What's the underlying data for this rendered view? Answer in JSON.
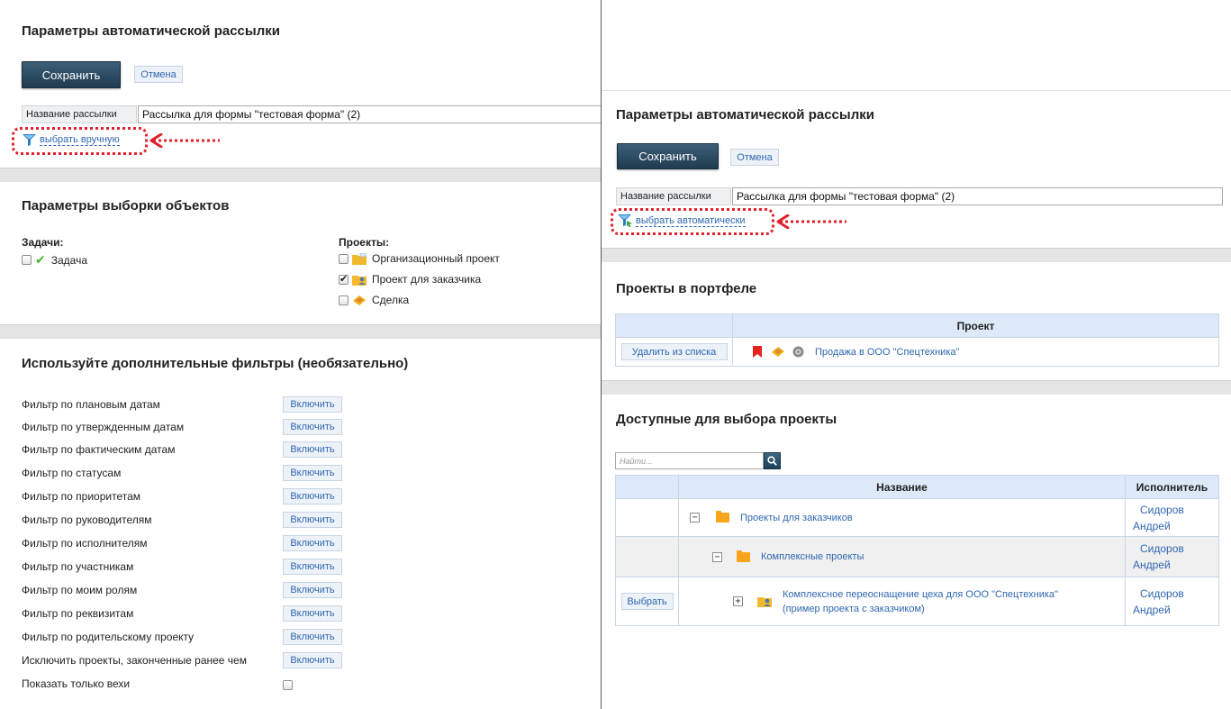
{
  "left": {
    "title": "Параметры автоматической рассылки",
    "save_label": "Сохранить",
    "cancel_label": "Отмена",
    "name_label": "Название рассылки",
    "name_value": "Рассылка для формы \"тестовая форма\" (2)",
    "select_link": "выбрать вручную",
    "selection_title": "Параметры выборки объектов",
    "tasks_label": "Задачи:",
    "task_item": "Задача",
    "projects_label": "Проекты:",
    "projects": [
      {
        "label": "Организационный проект",
        "checked": false
      },
      {
        "label": "Проект для заказчика",
        "checked": true
      },
      {
        "label": "Сделка",
        "checked": false
      }
    ],
    "filters_title": "Используйте дополнительные фильтры (необязательно)",
    "enable_label": "Включить",
    "filters": [
      "Фильтр по плановым датам",
      "Фильтр по утвержденным датам",
      "Фильтр по фактическим датам",
      "Фильтр по статусам",
      "Фильтр по приоритетам",
      "Фильтр по руководителям",
      "Фильтр по исполнителям",
      "Фильтр по участникам",
      "Фильтр по моим ролям",
      "Фильтр по реквизитам",
      "Фильтр по родительскому проекту",
      "Исключить проекты, законченные ранее чем"
    ],
    "milestones_label": "Показать только вехи"
  },
  "right": {
    "title": "Параметры автоматической рассылки",
    "save_label": "Сохранить",
    "cancel_label": "Отмена",
    "name_label": "Название рассылки",
    "name_value": "Рассылка для формы \"тестовая форма\" (2)",
    "select_link": "выбрать автоматически",
    "portfolio_title": "Проекты в портфеле",
    "portfolio_col_project": "Проект",
    "portfolio_row": {
      "action": "Удалить из списка",
      "project": "Продажа в ООО \"Спецтехника\""
    },
    "available_title": "Доступные для выбора проекты",
    "search_placeholder": "Найти...",
    "col_name": "Название",
    "col_executor": "Исполнитель",
    "rows": [
      {
        "name": "Проекты для заказчиков",
        "executor_1": "Сидоров",
        "executor_2": "Андрей",
        "toggle": "−"
      },
      {
        "name": "Комплексные проекты",
        "executor_1": "Сидоров",
        "executor_2": "Андрей",
        "toggle": "−"
      },
      {
        "name_1": "Комплексное переоснащение цеха для ООО \"Спецтехника\"",
        "name_2": "(пример проекта с заказчиком)",
        "executor_1": "Сидоров",
        "executor_2": "Андрей",
        "toggle": "+",
        "action": "Выбрать"
      }
    ]
  },
  "colors": {
    "accent_link": "#2f67b0",
    "annotation": "#e0212b",
    "button_dark": "#1f3b50",
    "header_bg": "#dde9f9"
  }
}
